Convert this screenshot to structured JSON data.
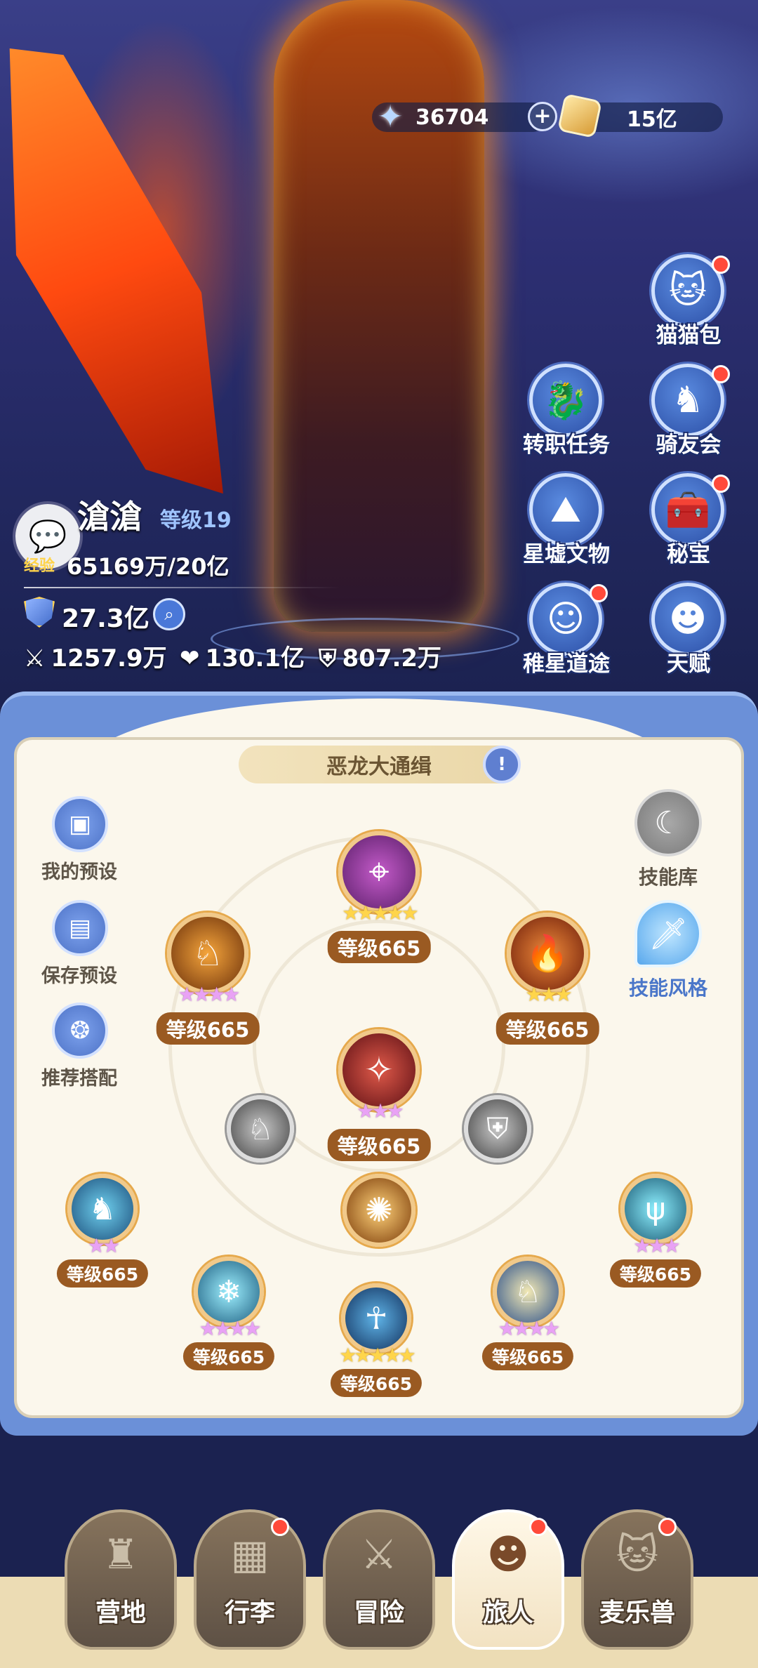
{
  "currency": {
    "stars": "36704",
    "plus": "+",
    "gold": "15亿"
  },
  "side_menu": {
    "mao_bao": "猫猫包",
    "zhuan_zhi": "转职任务",
    "qi_you": "骑友会",
    "xing_xu": "星墟文物",
    "mi_bao": "秘宝",
    "ji_xing": "稚星道途",
    "tian_fu": "天赋"
  },
  "player": {
    "name": "滄滄",
    "level": "等级19",
    "exp_label": "经验",
    "exp": "65169万/20亿",
    "power": "27.3亿",
    "attack": "1257.9万",
    "hp": "130.1亿",
    "defense": "807.2万"
  },
  "panel": {
    "title": "恶龙大通缉",
    "my_preset": "我的预设",
    "save_preset": "保存预设",
    "recommend": "推荐搭配",
    "skill_library": "技能库",
    "skill_style": "技能风格"
  },
  "skills": {
    "top": "等级665",
    "left_upper": "等级665",
    "right_upper": "等级665",
    "center": "等级665",
    "far_left": "等级665",
    "far_right": "等级665",
    "bottom_left": "等级665",
    "bottom_center": "等级665",
    "bottom_right": "等级665"
  },
  "nav": {
    "camp": "营地",
    "luggage": "行李",
    "adventure": "冒险",
    "traveler": "旅人",
    "pet": "麦乐兽"
  },
  "colors": {
    "panel_blue": "#6b90d8",
    "panel_cream": "#fbf7ec",
    "level_pill": "#9a5a22",
    "badge_red": "#ff4a3a"
  }
}
